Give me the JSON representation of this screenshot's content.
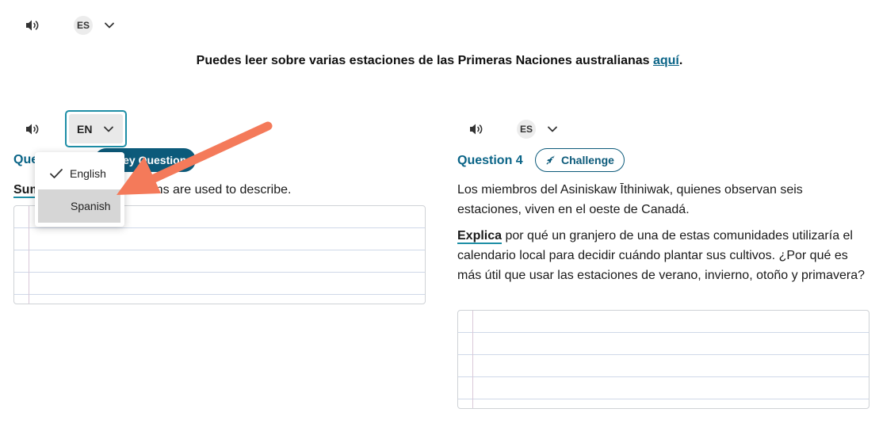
{
  "top_bar": {
    "lang_code": "ES"
  },
  "intro": {
    "text": "Puedes leer sobre varias estaciones de las Primeras Naciones australianas ",
    "link": "aquí",
    "end": "."
  },
  "left_panel": {
    "lang_select_value": "EN",
    "question_label_visible": "Que",
    "pill_label": "Key Question",
    "prompt_keyword": "Sum",
    "prompt_rest": "ns are used to describe."
  },
  "dropdown": {
    "items": [
      {
        "label": "English",
        "selected": true
      },
      {
        "label": "Spanish",
        "selected": false
      }
    ]
  },
  "right_panel": {
    "lang_code": "ES",
    "question_label": "Question 4",
    "pill_label": "Challenge",
    "paragraph1": "Los miembros del Asiniskaw Īthiniwak, quienes observan seis estaciones, viven en el oeste de Canadá.",
    "keyword": "Explica",
    "paragraph2": " por qué un granjero de una de estas comunidades utilizaría el calendario local para decidir cuándo plantar sus cultivos. ¿Por qué es más útil que usar las estaciones de verano, invierno, otoño y primavera?"
  },
  "colors": {
    "accent": "#0a6487",
    "focus_border": "#1e8ea6",
    "pill_fill": "#0c5a7a",
    "arrow": "#f47a5a",
    "menu_highlight": "#d6d6d6"
  },
  "icons": [
    "speaker-icon",
    "chevron-down-icon",
    "checkmark-icon",
    "rocket-icon"
  ]
}
